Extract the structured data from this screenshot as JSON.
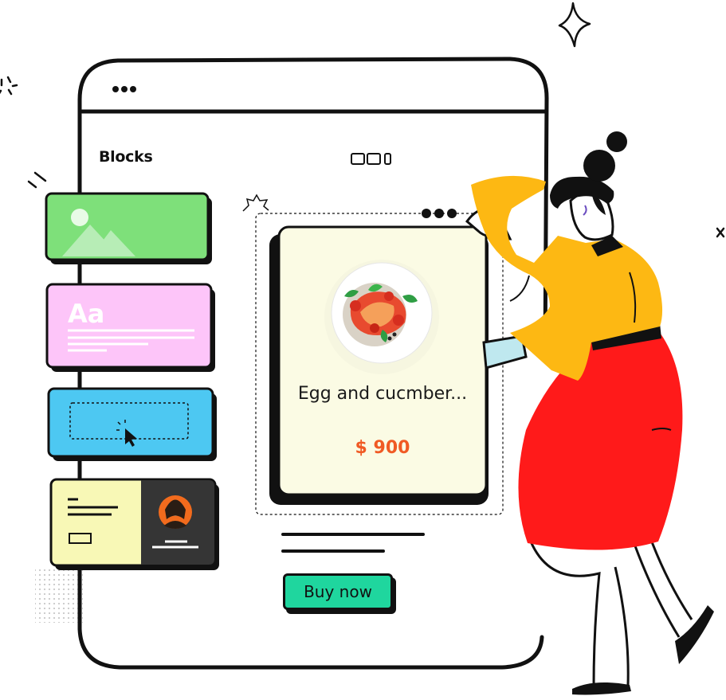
{
  "panel": {
    "title": "Blocks"
  },
  "blocks": [
    {
      "kind": "image"
    },
    {
      "kind": "text",
      "sample": "Aa"
    },
    {
      "kind": "button"
    },
    {
      "kind": "profile-card"
    }
  ],
  "product": {
    "name": "Egg and cucmber...",
    "price": "$ 900",
    "buy_label": "Buy now"
  },
  "colors": {
    "image_block": "#7ee07a",
    "text_block": "#fdc5f9",
    "button_block": "#4dc8f2",
    "card_block": "#f8f8b6",
    "product_card": "#fbfbe4",
    "price": "#f05a24",
    "buy_button": "#1fd69e",
    "shirt": "#fdb813",
    "skirt": "#ff1a1a"
  }
}
